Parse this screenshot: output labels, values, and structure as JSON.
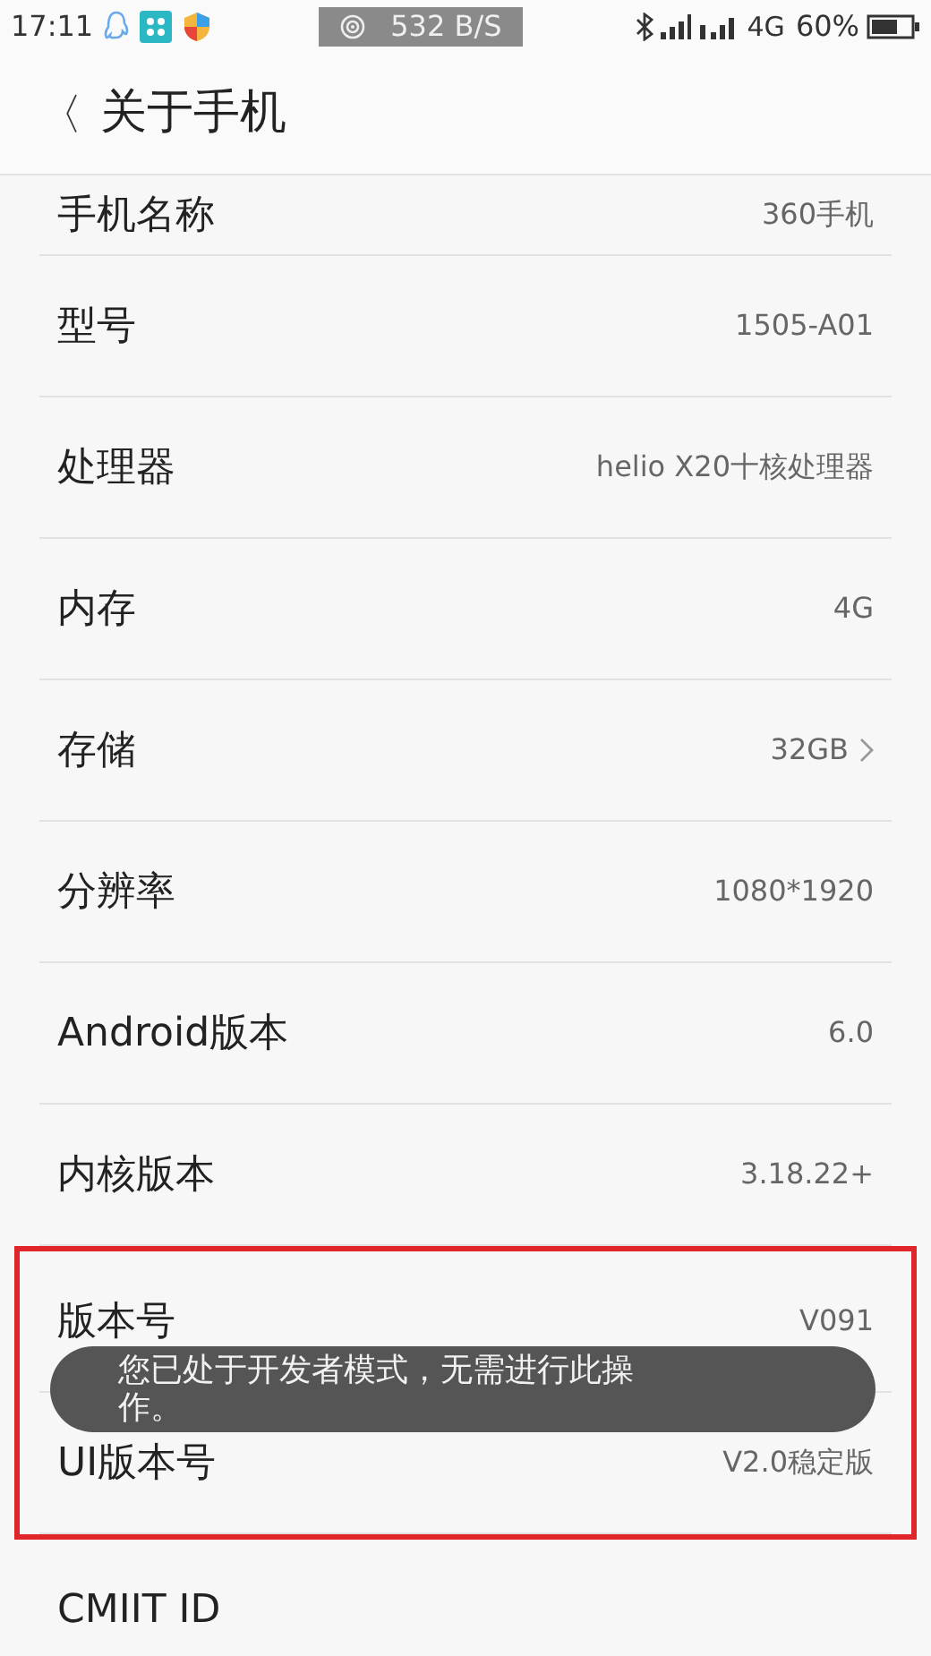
{
  "status_bar": {
    "time": "17:11",
    "net_speed": "532 B/S",
    "network": "4G",
    "battery": "60%"
  },
  "header": {
    "back": "〈",
    "title": "关于手机"
  },
  "rows": [
    {
      "label": "手机名称",
      "value": "360手机",
      "chevron": false,
      "highlighted": false
    },
    {
      "label": "型号",
      "value": "1505-A01",
      "chevron": false,
      "highlighted": false
    },
    {
      "label": "处理器",
      "value": "helio X20十核处理器",
      "chevron": false,
      "highlighted": false
    },
    {
      "label": "内存",
      "value": "4G",
      "chevron": false,
      "highlighted": false
    },
    {
      "label": "存储",
      "value": "32GB",
      "chevron": true,
      "highlighted": false
    },
    {
      "label": "分辨率",
      "value": "1080*1920",
      "chevron": false,
      "highlighted": false
    },
    {
      "label": "Android版本",
      "value": "6.0",
      "chevron": false,
      "highlighted": false
    },
    {
      "label": "内核版本",
      "value": "3.18.22+",
      "chevron": false,
      "highlighted": false
    },
    {
      "label": "版本号",
      "value": "V091",
      "chevron": false,
      "highlighted": true
    },
    {
      "label": "UI版本号",
      "value": "V2.0稳定版",
      "chevron": false,
      "highlighted": true
    },
    {
      "label": "CMIIT ID",
      "chevron": false,
      "highlighted": false
    }
  ],
  "toast": {
    "text": "您已处于开发者模式，无需进行此操作。"
  }
}
